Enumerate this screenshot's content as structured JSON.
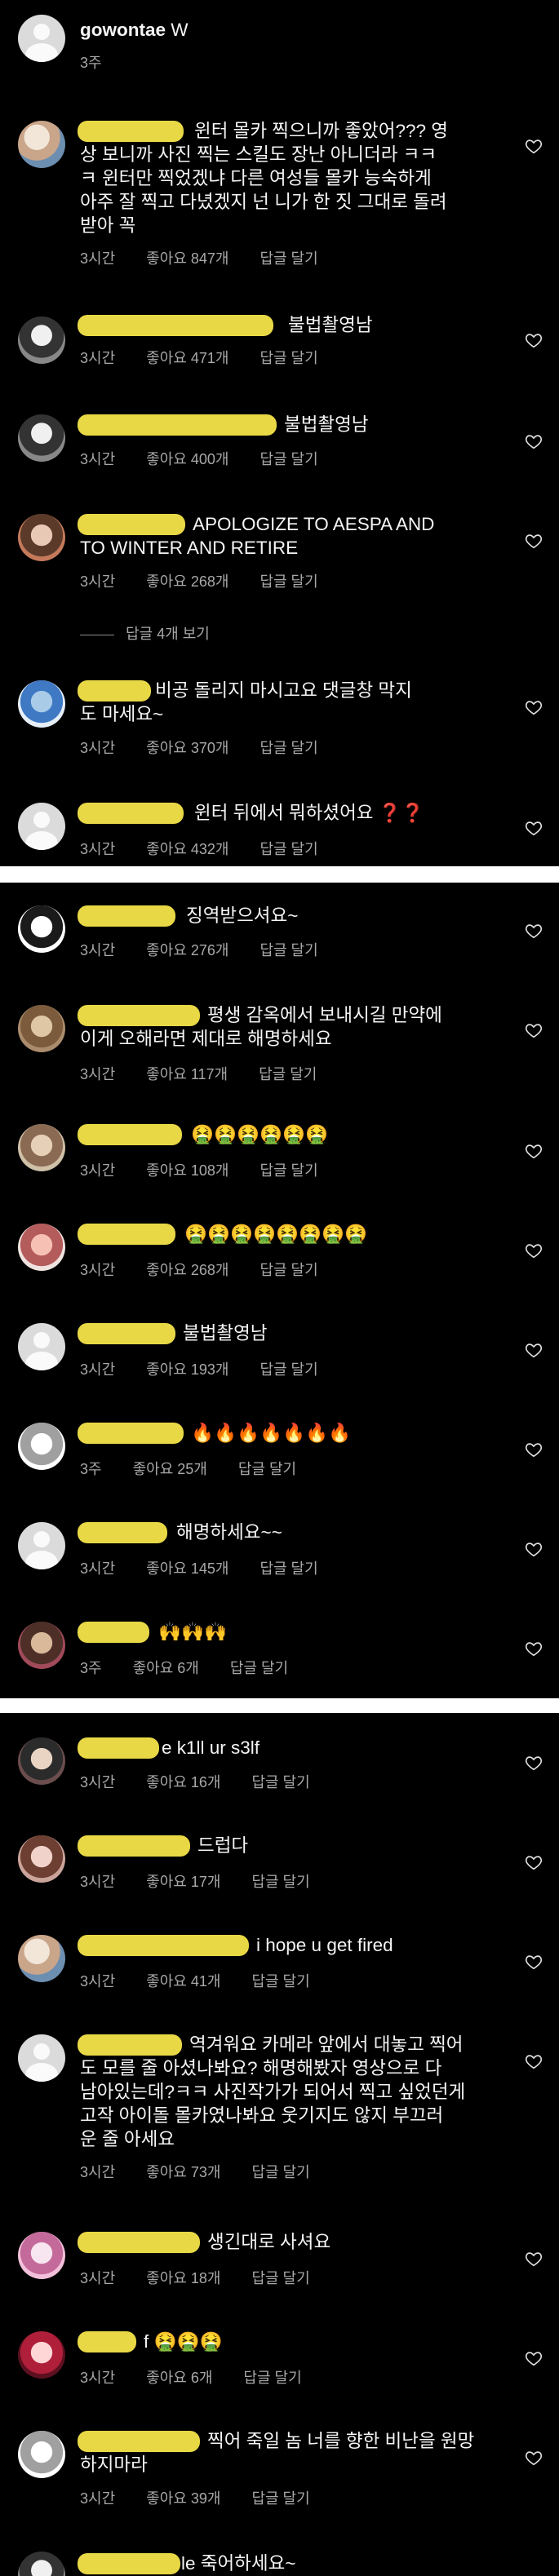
{
  "labels": {
    "like": "좋아요",
    "reply": "답글 달기"
  },
  "panel1": {
    "post": {
      "username": "gowontae",
      "caption": "W",
      "time": "3주"
    },
    "comments": [
      {
        "text": "윈터 몰카 찍으니까 좋았어??? 영\n상 보니까 사진 찍는 스킬도 장난 아니더라 ㅋㅋ\nㅋ 윈터만 찍었겠냐 다른 여성들 몰카 능숙하게\n아주 잘 찍고 다녔겠지 넌 니가 한 짓 그대로 돌려\n받아 꼭",
        "time": "3시간",
        "likes": "847개"
      },
      {
        "text": "불법촬영남",
        "time": "3시간",
        "likes": "471개"
      },
      {
        "text": "불법촬영남",
        "time": "3시간",
        "likes": "400개"
      },
      {
        "text": "APOLOGIZE TO AESPA AND\nTO WINTER AND RETIRE",
        "time": "3시간",
        "likes": "268개"
      },
      {
        "text": "비공 돌리지 마시고요 댓글창 막지\n도 마세요~",
        "time": "3시간",
        "likes": "370개"
      },
      {
        "text": "윈터 뒤에서 뭐하셨어요 ❓❓",
        "time": "3시간",
        "likes": "432개"
      }
    ],
    "view_replies": "답글 4개 보기"
  },
  "panel2": {
    "comments": [
      {
        "text": "징역받으셔요~",
        "time": "3시간",
        "likes": "276개"
      },
      {
        "text": "평생 감옥에서 보내시길 만약에\n이게 오해라면 제대로 해명하세요",
        "time": "3시간",
        "likes": "117개"
      },
      {
        "text": "🤮🤮🤮🤮🤮🤮",
        "time": "3시간",
        "likes": "108개"
      },
      {
        "text": "🤮🤮🤮🤮🤮🤮🤮🤮",
        "time": "3시간",
        "likes": "268개"
      },
      {
        "text": "불법촬영남",
        "time": "3시간",
        "likes": "193개"
      },
      {
        "text": "🔥🔥🔥🔥🔥🔥🔥",
        "time": "3주",
        "likes": "25개"
      },
      {
        "text": "해명하세요~~",
        "time": "3시간",
        "likes": "145개"
      },
      {
        "text": "🙌🙌🙌",
        "time": "3주",
        "likes": "6개"
      }
    ]
  },
  "panel3": {
    "comments": [
      {
        "text": "e k1ll ur s3lf",
        "time": "3시간",
        "likes": "16개"
      },
      {
        "text": "드럽다",
        "time": "3시간",
        "likes": "17개"
      },
      {
        "text": "i hope u get fired",
        "time": "3시간",
        "likes": "41개"
      },
      {
        "text": "역겨워요 카메라 앞에서 대놓고 찍어\n도 모를 줄 아셨나봐요? 해명해봤자 영상으로 다\n남아있는데?ㅋㅋ 사진작가가 되어서 찍고 싶었던게\n고작 아이돌 몰카였나봐요 웃기지도 않지 부끄러\n운 줄 아세요",
        "time": "3시간",
        "likes": "73개"
      },
      {
        "text": "생긴대로 사셔요",
        "time": "3시간",
        "likes": "18개"
      },
      {
        "text": "f 🤮🤮🤮",
        "time": "3시간",
        "likes": "6개"
      },
      {
        "text": "찍어 죽일 놈 너를 향한 비난을 원망\n하지마라",
        "time": "3시간",
        "likes": "39개"
      },
      {
        "text": "le 죽어하세요~",
        "time": "",
        "likes": ""
      }
    ]
  }
}
